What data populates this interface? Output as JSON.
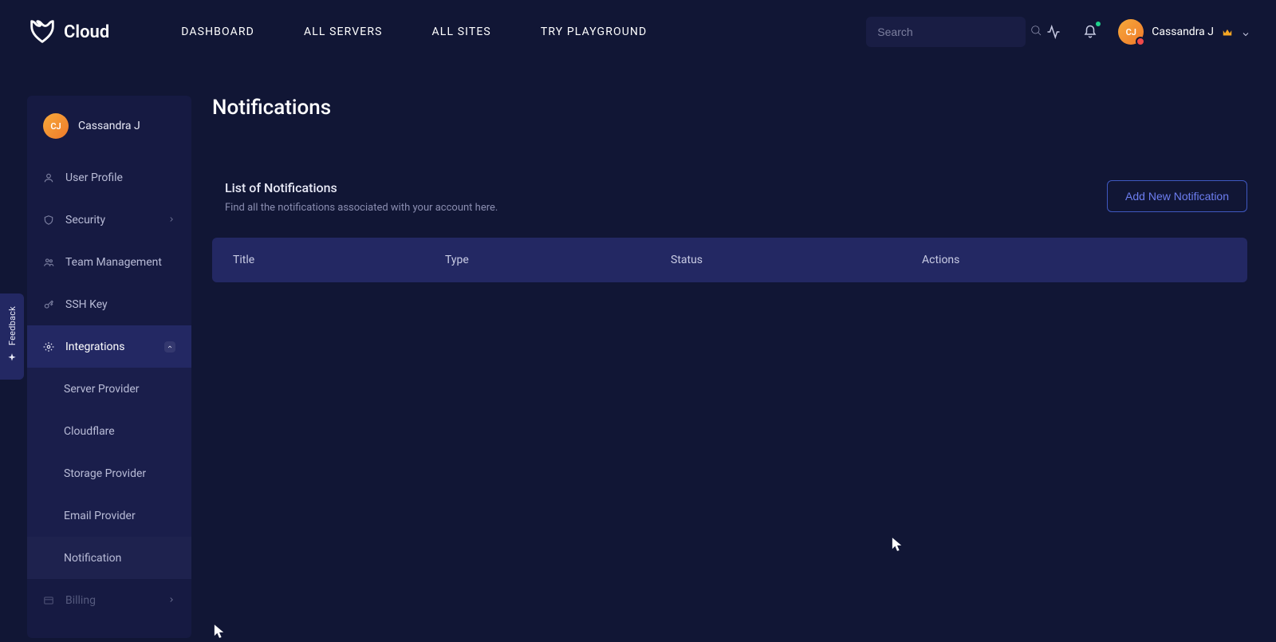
{
  "brand": {
    "name": "Cloud"
  },
  "nav": {
    "dashboard": "DASHBOARD",
    "servers": "ALL SERVERS",
    "sites": "ALL SITES",
    "playground": "TRY PLAYGROUND"
  },
  "search": {
    "placeholder": "Search"
  },
  "user": {
    "name": "Cassandra J",
    "initials": "CJ"
  },
  "sidebar": {
    "user_profile": "User Profile",
    "security": "Security",
    "team": "Team Management",
    "ssh": "SSH Key",
    "integrations": "Integrations",
    "sub": {
      "server": "Server Provider",
      "cloudflare": "Cloudflare",
      "storage": "Storage Provider",
      "email": "Email Provider",
      "notification": "Notification"
    },
    "billing": "Billing"
  },
  "feedback": {
    "label": "Feedback"
  },
  "page": {
    "title": "Notifications",
    "section_title": "List of Notifications",
    "section_desc": "Find all the notifications associated with your account here.",
    "add_btn": "Add New Notification",
    "cols": {
      "title": "Title",
      "type": "Type",
      "status": "Status",
      "actions": "Actions"
    }
  }
}
